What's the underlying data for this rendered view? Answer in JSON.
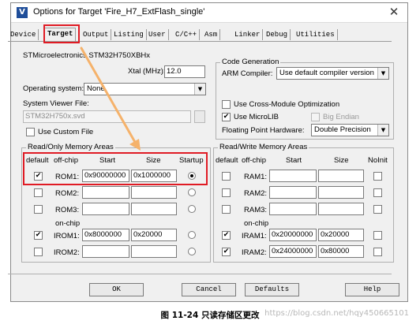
{
  "window": {
    "title": "Options for Target 'Fire_H7_ExtFlash_single'",
    "app_icon": "V",
    "close": "✕"
  },
  "tabs": [
    "Device",
    "Target",
    "Output",
    "Listing",
    "User",
    "C/C++",
    "Asm",
    "Linker",
    "Debug",
    "Utilities"
  ],
  "active_tab": "Target",
  "device": "STMicroelectronics STM32H750XBHx",
  "xtal": {
    "label": "Xtal (MHz):",
    "value": "12.0"
  },
  "os": {
    "label": "Operating system:",
    "value": "None"
  },
  "svf": {
    "label": "System Viewer File:",
    "value": "STM32H750x.svd",
    "custom_label": "Use Custom File"
  },
  "codegen": {
    "title": "Code Generation",
    "arm_compiler_label": "ARM Compiler:",
    "arm_compiler_value": "Use default compiler version",
    "cross_module": "Use Cross-Module Optimization",
    "microlib": "Use MicroLIB",
    "big_endian": "Big Endian",
    "fp_label": "Floating Point Hardware:",
    "fp_value": "Double Precision"
  },
  "rom_areas": {
    "title": "Read/Only Memory Areas",
    "headers": {
      "default": "default",
      "offchip": "off-chip",
      "start": "Start",
      "size": "Size",
      "startup": "Startup"
    },
    "onchip_label": "on-chip",
    "rows": [
      {
        "name": "ROM1:",
        "default": true,
        "start": "0x90000000",
        "size": "0x1000000",
        "startup": true
      },
      {
        "name": "ROM2:",
        "default": false,
        "start": "",
        "size": "",
        "startup": false
      },
      {
        "name": "ROM3:",
        "default": false,
        "start": "",
        "size": "",
        "startup": false
      },
      {
        "name": "IROM1:",
        "default": true,
        "start": "0x8000000",
        "size": "0x20000",
        "startup": false
      },
      {
        "name": "IROM2:",
        "default": false,
        "start": "",
        "size": "",
        "startup": false
      }
    ]
  },
  "ram_areas": {
    "title": "Read/Write Memory Areas",
    "headers": {
      "default": "default",
      "offchip": "off-chip",
      "start": "Start",
      "size": "Size",
      "noinit": "NoInit"
    },
    "onchip_label": "on-chip",
    "rows": [
      {
        "name": "RAM1:",
        "default": false,
        "start": "",
        "size": "",
        "noinit": false
      },
      {
        "name": "RAM2:",
        "default": false,
        "start": "",
        "size": "",
        "noinit": false
      },
      {
        "name": "RAM3:",
        "default": false,
        "start": "",
        "size": "",
        "noinit": false
      },
      {
        "name": "IRAM1:",
        "default": true,
        "start": "0x20000000",
        "size": "0x20000",
        "noinit": false
      },
      {
        "name": "IRAM2:",
        "default": true,
        "start": "0x24000000",
        "size": "0x80000",
        "noinit": false
      }
    ]
  },
  "buttons": {
    "ok": "OK",
    "cancel": "Cancel",
    "defaults": "Defaults",
    "help": "Help"
  },
  "caption": "图 11-24 只读存储区更改",
  "watermark": "https://blog.csdn.net/hqy450665101",
  "colors": {
    "highlight_box": "#e01b24",
    "arrow": "#f5b26b"
  }
}
